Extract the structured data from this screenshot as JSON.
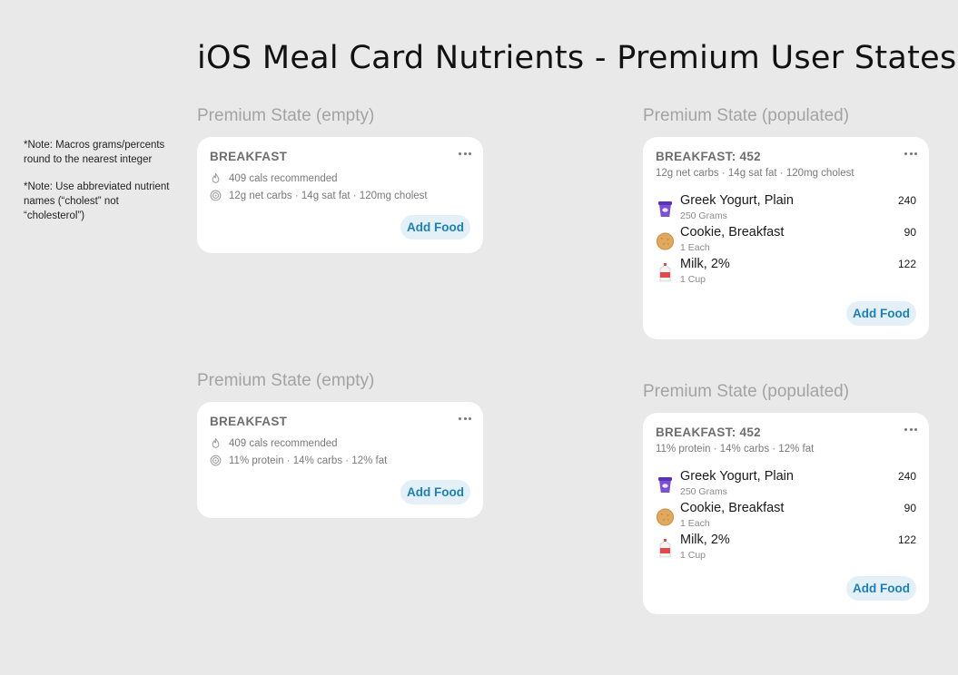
{
  "page_title": "iOS Meal Card Nutrients - Premium User States",
  "notes": [
    "*Note: Macros grams/percents round to the nearest integer",
    "*Note: Use abbreviated nutrient names (“cholest” not “cholesterol”)"
  ],
  "states": {
    "empty_1": {
      "label": "Premium State (empty)",
      "meal_title": "BREAKFAST",
      "calories_text": "409 cals recommended",
      "nutrients_text": "12g net carbs · 14g sat fat · 120mg cholest",
      "add_food_label": "Add Food"
    },
    "populated_1": {
      "label": "Premium State (populated)",
      "meal_title": "BREAKFAST: 452",
      "nutrients_text": "12g net carbs · 14g sat fat · 120mg cholest",
      "foods": [
        {
          "name": "Greek Yogurt, Plain",
          "serving": "250 Grams",
          "calories": "240",
          "icon": "yogurt-icon"
        },
        {
          "name": "Cookie, Breakfast",
          "serving": "1 Each",
          "calories": "90",
          "icon": "cookie-icon"
        },
        {
          "name": "Milk, 2%",
          "serving": "1 Cup",
          "calories": "122",
          "icon": "milk-carton-icon"
        }
      ],
      "add_food_label": "Add Food"
    },
    "empty_2": {
      "label": "Premium State (empty)",
      "meal_title": "BREAKFAST",
      "calories_text": "409 cals recommended",
      "nutrients_text": "11% protein · 14% carbs · 12% fat",
      "add_food_label": "Add Food"
    },
    "populated_2": {
      "label": "Premium State (populated)",
      "meal_title": "BREAKFAST: 452",
      "nutrients_text": "11% protein · 14% carbs · 12% fat",
      "foods": [
        {
          "name": "Greek Yogurt, Plain",
          "serving": "250 Grams",
          "calories": "240",
          "icon": "yogurt-icon"
        },
        {
          "name": "Cookie, Breakfast",
          "serving": "1 Each",
          "calories": "90",
          "icon": "cookie-icon"
        },
        {
          "name": "Milk, 2%",
          "serving": "1 Cup",
          "calories": "122",
          "icon": "milk-carton-icon"
        }
      ],
      "add_food_label": "Add Food"
    }
  },
  "colors": {
    "background": "#e9e9e9",
    "card": "#ffffff",
    "accent": "#1d7fb8",
    "button_bg": "#e3f0f8",
    "label_gray": "#a3a3a3"
  }
}
